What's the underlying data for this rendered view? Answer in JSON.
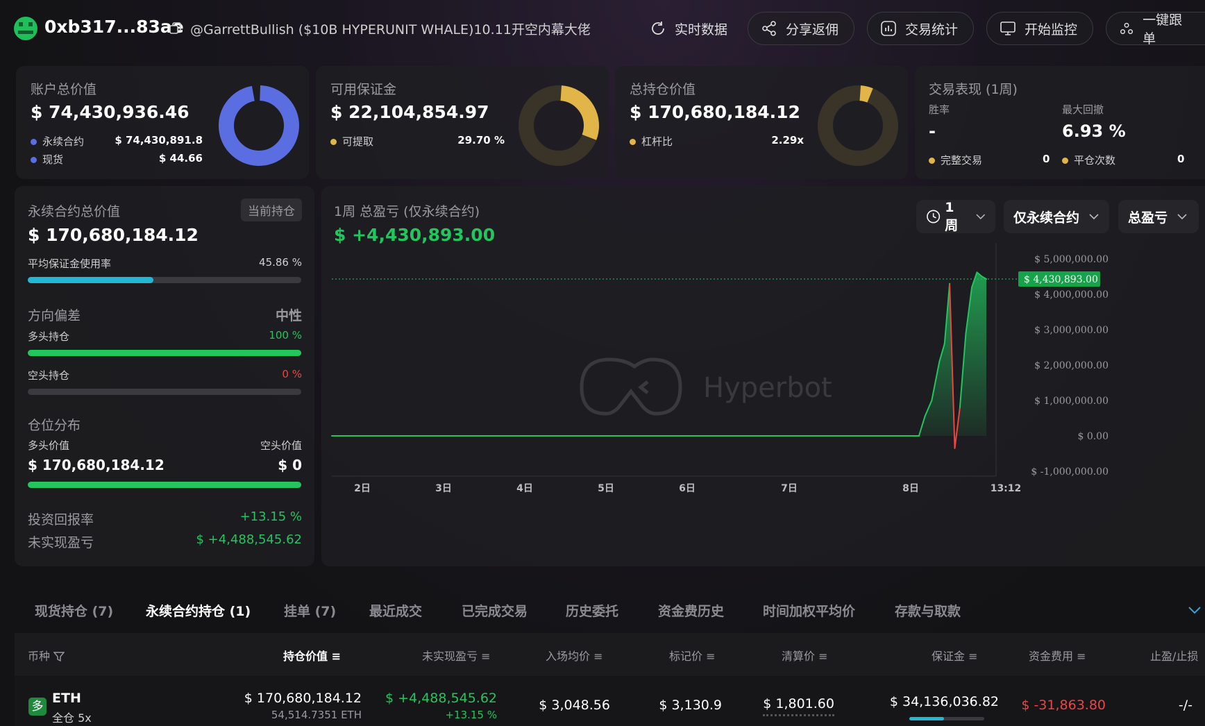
{
  "header": {
    "address": "0xb317...83ae",
    "tag": "@GarrettBullish ($10B HYPERUNIT WHALE)10.11开空内幕大佬",
    "buttons": {
      "realtime": "实时数据",
      "share": "分享返佣",
      "stats": "交易统计",
      "monitor": "开始监控",
      "copytrade": "一键跟单"
    }
  },
  "cards": {
    "account": {
      "label": "账户总价值",
      "value": "$ 74,430,936.46",
      "perp_label": "永续合约",
      "perp_value": "$ 74,430,891.8",
      "spot_label": "现货",
      "spot_value": "$ 44.66",
      "perp_share": 0.9999994,
      "color_perp": "#5b6ee1",
      "color_spot": "#5b6ee1"
    },
    "margin": {
      "label": "可用保证金",
      "value": "$ 22,104,854.97",
      "sub_label": "可提取",
      "sub_value": "29.70 %",
      "ratio": 0.297,
      "color": "#e2b548"
    },
    "position": {
      "label": "总持仓价值",
      "value": "$ 170,680,184.12",
      "sub_label": "杠杆比",
      "sub_value": "2.29x",
      "ratio": 0.05,
      "color": "#e2b548"
    },
    "performance": {
      "label": "交易表现 (1周)",
      "winrate_label": "胜率",
      "winrate_value": "-",
      "drawdown_label": "最大回撤",
      "drawdown_value": "6.93 %",
      "complete_label": "完整交易",
      "complete_value": "0",
      "close_label": "平仓次数",
      "close_value": "0"
    }
  },
  "perp_panel": {
    "label": "永续合约总价值",
    "badge": "当前持仓",
    "value": "$ 170,680,184.12",
    "margin_use_label": "平均保证金使用率",
    "margin_use_value": "45.86 %",
    "margin_use_ratio": 0.4586,
    "bias_label": "方向偏差",
    "bias_value": "中性",
    "long_label": "多头持仓",
    "long_value": "100 %",
    "long_ratio": 1.0,
    "short_label": "空头持仓",
    "short_value": "0 %",
    "short_ratio": 0,
    "dist_label": "仓位分布",
    "long_val_label": "多头价值",
    "short_val_label": "空头价值",
    "long_val": "$ 170,680,184.12",
    "short_val": "$ 0",
    "roi_label": "投资回报率",
    "roi_value": "+13.15 %",
    "upnl_label": "未实现盈亏",
    "upnl_value": "$ +4,488,545.62"
  },
  "pnl_panel": {
    "title": "1周 总盈亏 (仅永续合约)",
    "value": "$ +4,430,893.00",
    "filters": {
      "period": "1周",
      "scope": "仅永续合约",
      "metric": "总盈亏"
    },
    "watermark": "Hyperbot"
  },
  "chart_data": {
    "type": "area",
    "x_labels": [
      "2日",
      "3日",
      "4日",
      "5日",
      "6日",
      "7日",
      "8日",
      "13:12"
    ],
    "y_ticks": [
      "$ 5,000,000.00",
      "$ 4,000,000.00",
      "$ 3,000,000.00",
      "$ 2,000,000.00",
      "$ 1,000,000.00",
      "$ 0.00",
      "$ -1,000,000.00"
    ],
    "ylim": [
      -1000000,
      5000000
    ],
    "current_label": "$ 4,430,893.00",
    "current_value": 4430893,
    "series": [
      {
        "t": [
          0,
          6.88,
          6.95,
          7.03,
          7.12,
          7.18,
          7.24,
          7.3,
          7.36,
          7.43,
          7.5,
          7.56,
          7.62,
          7.67
        ],
        "values": [
          0,
          0,
          550000,
          1000000,
          2100000,
          2600000,
          4300000,
          -350000,
          800000,
          2900000,
          4200000,
          4620000,
          4500000,
          4430893
        ]
      }
    ],
    "colors": {
      "line": "#22c55e",
      "negative": "#ef4444"
    }
  },
  "tabs": [
    "现货持仓 (7)",
    "永续合约持仓 (1)",
    "挂单 (7)",
    "最近成交",
    "已完成交易",
    "历史委托",
    "资金费历史",
    "时间加权平均价",
    "存款与取款"
  ],
  "table": {
    "headers": [
      "币种",
      "持仓价值",
      "未实现盈亏",
      "入场均价",
      "标记价",
      "清算价",
      "保证金",
      "资金费用",
      "止盈/止损"
    ],
    "rows": [
      {
        "side_badge": "多",
        "coin": "ETH",
        "mode": "全仓 5x",
        "value": "$ 170,680,184.12",
        "size": "54,514.7351 ETH",
        "upnl": "$ +4,488,545.62",
        "upnl_pct": "+13.15 %",
        "entry": "$ 3,048.56",
        "mark": "$ 3,130.9",
        "liq": "$ 1,801.60",
        "margin": "$ 34,136,036.82",
        "funding": "$ -31,863.80",
        "tpsl": "-/-"
      }
    ]
  }
}
